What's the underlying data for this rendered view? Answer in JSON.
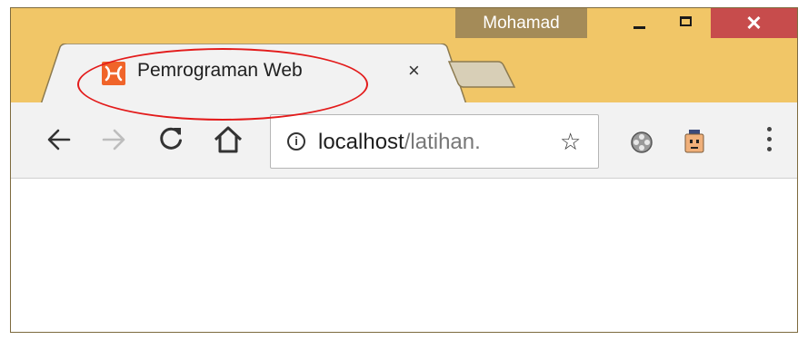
{
  "window": {
    "profile_name": "Mohamad",
    "close_glyph": "✕",
    "accent_color": "#f1c667",
    "close_color": "#c74c4c"
  },
  "tabs": [
    {
      "title": "Pemrograman Web",
      "active": true,
      "close_glyph": "×",
      "favicon": "xampp-icon"
    }
  ],
  "toolbar": {
    "back": "arrow-left-icon",
    "forward": "arrow-right-icon",
    "reload": "reload-icon",
    "home": "home-icon"
  },
  "address_bar": {
    "host": "localhost",
    "path": "/latihan.",
    "info_glyph": "i",
    "bookmark_glyph": "☆"
  },
  "annotation": {
    "color": "#e31b1b",
    "shape": "ellipse"
  }
}
